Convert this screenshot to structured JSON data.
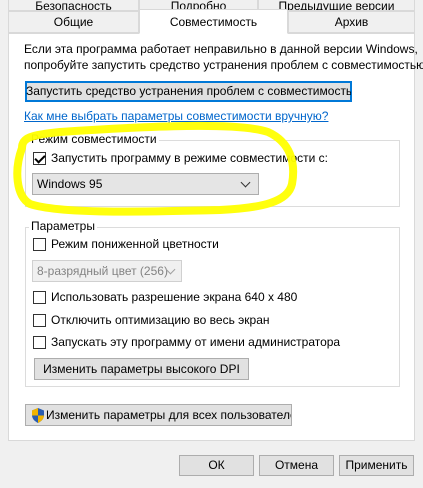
{
  "tabs": {
    "row1": [
      "Безопасность",
      "Подробно",
      "Предыдущие версии"
    ],
    "row2": [
      "Общие",
      "Совместимость",
      "Архив"
    ],
    "active": "Совместимость"
  },
  "intro": {
    "line1": "Если эта программа работает неправильно в данной версии Windows,",
    "line2": "попробуйте запустить средство устранения проблем с совместимостью."
  },
  "troubleshoot_button": "Запустить средство устранения проблем с совместимостью",
  "manual_link": "Как мне выбрать параметры совместимости вручную?",
  "compat_mode": {
    "title": "Режим совместимости",
    "checkbox_label": "Запустить программу в режиме совместимости с:",
    "checked": true,
    "selected_os": "Windows 95"
  },
  "params": {
    "title": "Параметры",
    "reduced_color_label": "Режим пониженной цветности",
    "color_option": "8-разрядный цвет (256)",
    "resolution_label": "Использовать разрешение экрана 640 x 480",
    "fullscreen_opt_label": "Отключить оптимизацию во весь экран",
    "admin_label": "Запускать эту программу от имени администратора",
    "dpi_button": "Изменить параметры высокого DPI"
  },
  "all_users_button": "Изменить параметры для всех пользователей",
  "footer": {
    "ok": "ОК",
    "cancel": "Отмена",
    "apply": "Применить"
  },
  "colors": {
    "highlight": "#ffff00",
    "link": "#0066cc",
    "focus_border": "#0078d7"
  },
  "icons": {
    "all_users_button": "uac-shield-icon"
  }
}
